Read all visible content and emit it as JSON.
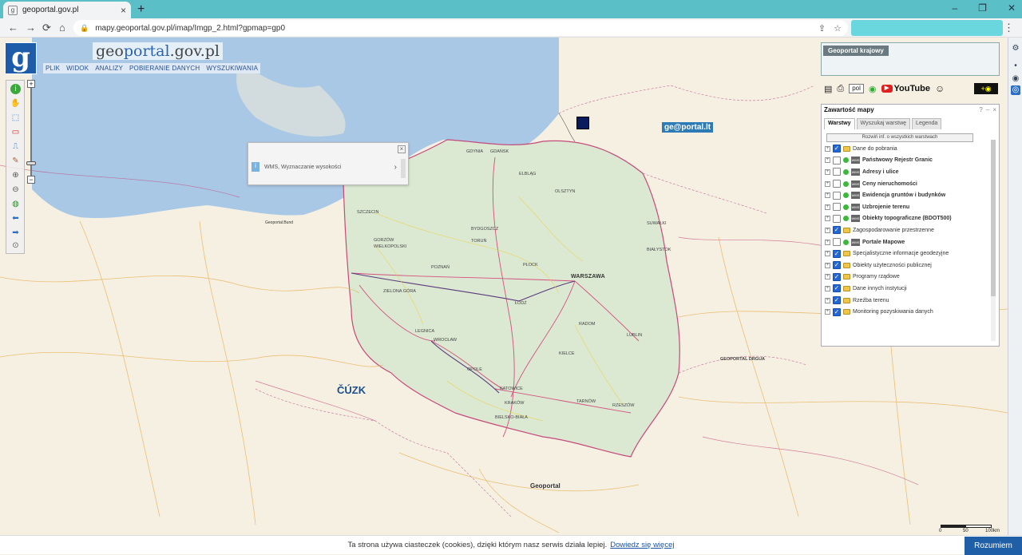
{
  "browser": {
    "tab_title": "geoportal.gov.pl",
    "tab_close": "×",
    "new_tab": "+",
    "url": "mapy.geoportal.gov.pl/imap/Imgp_2.html?gpmap=gp0",
    "back": "←",
    "forward": "→",
    "reload": "⟳",
    "home": "⌂",
    "menu": "⋮"
  },
  "header": {
    "logo_letter": "g",
    "brand_prefix": "geo",
    "brand_main": "portal",
    "brand_suffix": ".gov.pl",
    "menu": [
      "PLIK",
      "WIDOK",
      "ANALIZY",
      "POBIERANIE DANYCH",
      "WYSZUKIWANIA"
    ]
  },
  "popup": {
    "text": "WMS, Wyznaczanie wysokości",
    "close": "×"
  },
  "overview": {
    "title": "Geoportal krajowy"
  },
  "iconbar": {
    "language": "pol",
    "youtube": "YouTube"
  },
  "panel": {
    "title": "Zawartość mapy",
    "tabs": [
      "Warstwy",
      "Wyszukaj warstwę",
      "Legenda"
    ],
    "expand_button": "Rozwiń inf. o wszystkich warstwach",
    "layers": [
      {
        "name": "Dane do pobrania",
        "checked": true,
        "type": "folder",
        "bold": false
      },
      {
        "name": "Państwowy Rejestr Granic",
        "checked": false,
        "type": "wms",
        "bold": true
      },
      {
        "name": "Adresy i ulice",
        "checked": false,
        "type": "wms",
        "bold": true
      },
      {
        "name": "Ceny nieruchomości",
        "checked": false,
        "type": "wms",
        "bold": true
      },
      {
        "name": "Ewidencja gruntów i budynków",
        "checked": false,
        "type": "wms",
        "bold": true
      },
      {
        "name": "Uzbrojenie terenu",
        "checked": false,
        "type": "wms",
        "bold": true
      },
      {
        "name": "Obiekty topograficzne (BDOT500)",
        "checked": false,
        "type": "wms",
        "bold": true
      },
      {
        "name": "Zagospodarowanie przestrzenne",
        "checked": true,
        "type": "folder",
        "bold": false
      },
      {
        "name": "Portale Mapowe",
        "checked": false,
        "type": "wms",
        "bold": true
      },
      {
        "name": "Specjalistyczne informacje geodezyjne",
        "checked": true,
        "type": "folder",
        "bold": false
      },
      {
        "name": "Obiekty użyteczności publicznej",
        "checked": true,
        "type": "folder",
        "bold": false
      },
      {
        "name": "Programy rządowe",
        "checked": true,
        "type": "folder",
        "bold": false
      },
      {
        "name": "Dane innych instytucji",
        "checked": true,
        "type": "folder",
        "bold": false
      },
      {
        "name": "Rzeźba terenu",
        "checked": true,
        "type": "folder",
        "bold": false
      },
      {
        "name": "Monitoring pozyskiwania danych",
        "checked": true,
        "type": "folder",
        "bold": false
      }
    ]
  },
  "map_labels": {
    "geoportal_lt": "ge@portal.lt",
    "cuzk": "ČÚZK",
    "geoportal_sk": "Geoportal",
    "geoportal_de": "Geoportal.Bund",
    "geoportal_ua": "GEOPORTAL DRGUA"
  },
  "cities": [
    "GDYNIA",
    "GDAŃSK",
    "ELBLĄG",
    "OLSZTYN",
    "SUWAŁKI",
    "SZCZECIN",
    "BYDGOSZCZ",
    "TORUŃ",
    "GORZÓW WIELKOPOLSKI",
    "POZNAŃ",
    "PŁOCK",
    "BIAŁYSTOK",
    "WARSZAWA",
    "ZIELONA GÓRA",
    "ŁÓDŹ",
    "RADOM",
    "LUBLIN",
    "WROCŁAW",
    "KIELCE",
    "OPOLE",
    "KATOWICE",
    "KRAKÓW",
    "TARNÓW",
    "RZESZÓW",
    "BIELSKO-BIAŁA",
    "LEGNICA"
  ],
  "scale": {
    "l0": "0",
    "l1": "50",
    "l2": "100km"
  },
  "cookie": {
    "text": "Ta strona używa ciasteczek (cookies), dzięki którym nasz serwis działa lepiej.",
    "link": "Dowiedz się więcej",
    "button": "Rozumiem"
  }
}
